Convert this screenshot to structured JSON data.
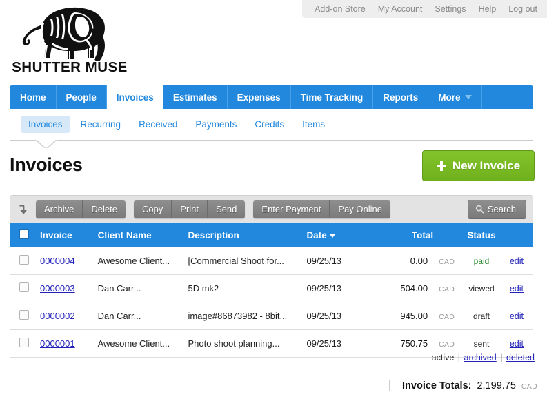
{
  "topbar": {
    "links": [
      {
        "label": "Add-on Store"
      },
      {
        "label": "My Account"
      },
      {
        "label": "Settings"
      },
      {
        "label": "Help"
      },
      {
        "label": "Log out"
      }
    ]
  },
  "brand": {
    "name": "SHUTTER MUSE",
    "logo_icon": "elephant-logo-icon"
  },
  "mainnav": {
    "items": [
      {
        "label": "Home",
        "active": false
      },
      {
        "label": "People",
        "active": false
      },
      {
        "label": "Invoices",
        "active": true
      },
      {
        "label": "Estimates",
        "active": false
      },
      {
        "label": "Expenses",
        "active": false
      },
      {
        "label": "Time Tracking",
        "active": false
      },
      {
        "label": "Reports",
        "active": false
      },
      {
        "label": "More",
        "active": false
      }
    ]
  },
  "subnav": {
    "items": [
      {
        "label": "Invoices",
        "active": true
      },
      {
        "label": "Recurring",
        "active": false
      },
      {
        "label": "Received",
        "active": false
      },
      {
        "label": "Payments",
        "active": false
      },
      {
        "label": "Credits",
        "active": false
      },
      {
        "label": "Items",
        "active": false
      }
    ]
  },
  "page": {
    "title": "Invoices",
    "new_invoice_label": "New Invoice"
  },
  "toolbar": {
    "download_icon": "download-arrow-icon",
    "group1": [
      "Archive",
      "Delete"
    ],
    "group2": [
      "Copy",
      "Print",
      "Send"
    ],
    "group3": [
      "Enter Payment",
      "Pay Online"
    ],
    "search_label": "Search",
    "search_icon": "magnifier-icon"
  },
  "table": {
    "columns": [
      "Invoice",
      "Client Name",
      "Description",
      "Date",
      "Total",
      "Status"
    ],
    "sorted_column": "Date",
    "sort_direction": "desc",
    "currency": "CAD",
    "edit_label": "edit",
    "rows": [
      {
        "invoice": "0000004",
        "client": "Awesome Client...",
        "description": "[Commercial Shoot for...",
        "date": "09/25/13",
        "total": "0.00",
        "currency": "CAD",
        "status": "paid",
        "status_color": "#2e8b2e",
        "edit": "edit"
      },
      {
        "invoice": "0000003",
        "client": "Dan Carr...",
        "description": "5D mk2",
        "date": "09/25/13",
        "total": "504.00",
        "currency": "CAD",
        "status": "viewed",
        "status_color": "#222222",
        "edit": "edit"
      },
      {
        "invoice": "0000002",
        "client": "Dan Carr...",
        "description": "image#86873982 - 8bit...",
        "date": "09/25/13",
        "total": "945.00",
        "currency": "CAD",
        "status": "draft",
        "status_color": "#222222",
        "edit": "edit"
      },
      {
        "invoice": "0000001",
        "client": "Awesome Client...",
        "description": "Photo shoot planning...",
        "date": "09/25/13",
        "total": "750.75",
        "currency": "CAD",
        "status": "sent",
        "status_color": "#222222",
        "edit": "edit"
      }
    ]
  },
  "state_filter": {
    "active": "active",
    "archived": "archived",
    "deleted": "deleted",
    "separator": "|"
  },
  "totals": {
    "label": "Invoice Totals:",
    "value": "2,199.75",
    "currency": "CAD"
  },
  "colors": {
    "nav_blue": "#2288dd",
    "button_green": "#77bb22",
    "link_blue": "#2222bb",
    "paid_green": "#2e8b2e",
    "toolbar_gray": "#e3e3e3"
  }
}
